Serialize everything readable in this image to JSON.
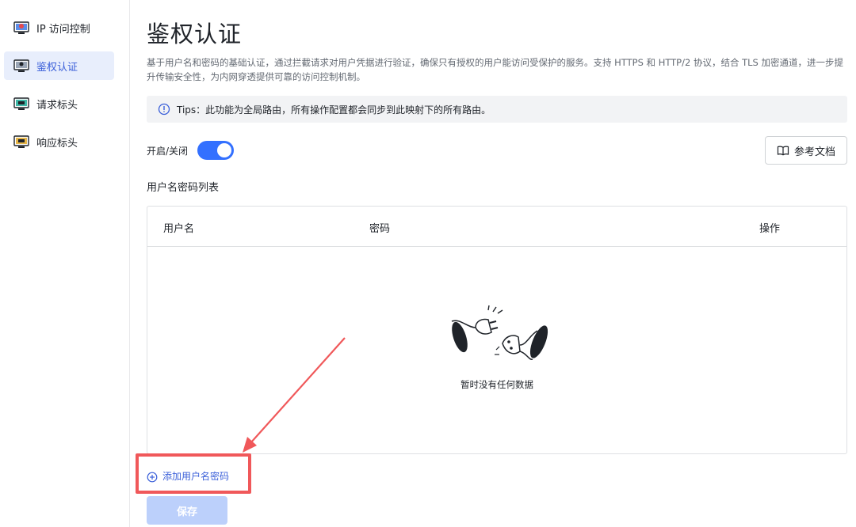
{
  "sidebar": {
    "items": [
      {
        "label": "IP 访问控制",
        "icon": "ip-access-icon",
        "active": false
      },
      {
        "label": "鉴权认证",
        "icon": "auth-icon",
        "active": true
      },
      {
        "label": "请求标头",
        "icon": "request-header-icon",
        "active": false
      },
      {
        "label": "响应标头",
        "icon": "response-header-icon",
        "active": false
      }
    ]
  },
  "main": {
    "title": "鉴权认证",
    "description": "基于用户名和密码的基础认证，通过拦截请求对用户凭据进行验证，确保只有授权的用户能访问受保护的服务。支持 HTTPS 和 HTTP/2 协议，结合 TLS 加密通道，进一步提升传输安全性，为内网穿透提供可靠的访问控制机制。",
    "tips": "Tips：此功能为全局路由，所有操作配置都会同步到此映射下的所有路由。",
    "toggle_label": "开启/关闭",
    "toggle_on": true,
    "doc_button": "参考文档",
    "list_title": "用户名密码列表",
    "table": {
      "columns": [
        "用户名",
        "密码",
        "操作"
      ],
      "rows": [],
      "empty_text": "暂时没有任何数据"
    },
    "add_link": "添加用户名密码",
    "save_button": "保存"
  },
  "colors": {
    "accent": "#3370ff",
    "link": "#3a5fd9",
    "save_disabled": "#bcd0fb",
    "annotation": "#f0585a",
    "active_bg": "#e8eefc"
  }
}
